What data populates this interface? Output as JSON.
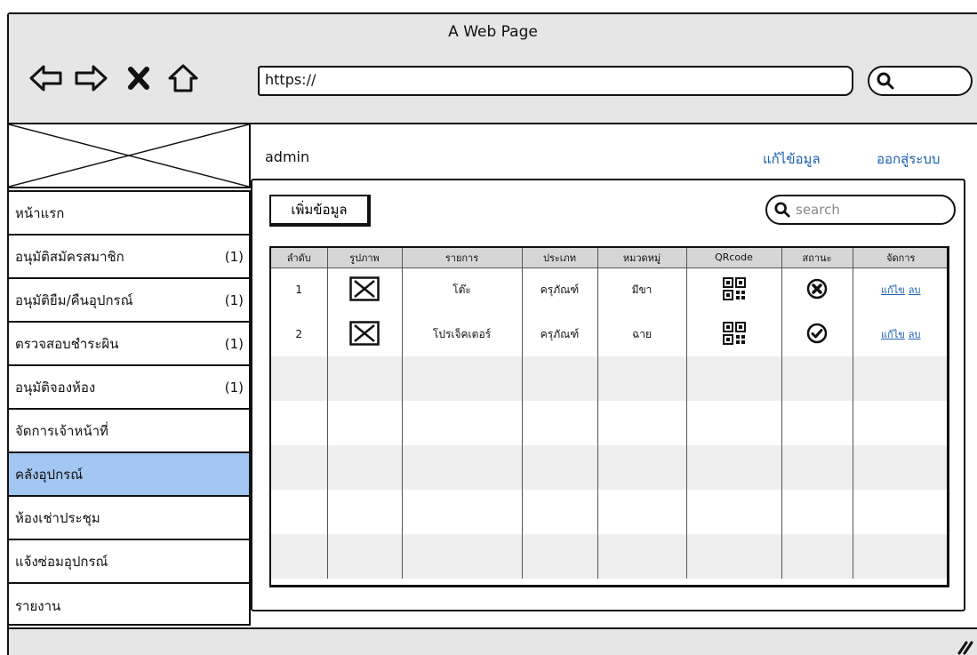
{
  "window": {
    "title": "A Web Page"
  },
  "browser": {
    "url": "https://"
  },
  "user": {
    "name": "admin"
  },
  "top_links": {
    "edit_profile": "แก้ไข้อมูล",
    "logout": "ออกสู่ระบบ"
  },
  "sidebar": {
    "items": [
      {
        "label": "หน้าแรก",
        "count": ""
      },
      {
        "label": "อนุมัติสมัครสมาชิก",
        "count": "(1)"
      },
      {
        "label": "อนุมัติยืม/คืนอุปกรณ์",
        "count": "(1)"
      },
      {
        "label": "ตรวจสอบชำระผิน",
        "count": "(1)"
      },
      {
        "label": "อนุมัติจองห้อง",
        "count": "(1)"
      },
      {
        "label": "จัดการเจ้าหน้าที่",
        "count": ""
      },
      {
        "label": "คลังอุปกรณ์",
        "count": "",
        "active": true
      },
      {
        "label": "ห้องเช่าประชุม",
        "count": ""
      },
      {
        "label": "แจ้งซ่อมอุปกรณ์",
        "count": ""
      },
      {
        "label": "รายงาน",
        "count": ""
      }
    ]
  },
  "toolbar": {
    "add_label": "เพิ่มข้อมูล",
    "search_placeholder": "search"
  },
  "table": {
    "headers": [
      "ลำดับ",
      "รูปภาพ",
      "รายการ",
      "ประเภท",
      "หมวดหมู่",
      "QRcode",
      "สถานะ",
      "จัดการ"
    ],
    "rows": [
      {
        "no": "1",
        "item": "โต๊ะ",
        "type": "ครุภัณฑ์",
        "category": "มีขา",
        "status_icon": "x-circle-icon",
        "edit": "แก้ไข",
        "delete": "ลบ"
      },
      {
        "no": "2",
        "item": "โปรเจ็คเตอร์",
        "type": "ครุภัณฑ์",
        "category": "ฉาย",
        "status_icon": "check-circle-icon",
        "edit": "แก้ไข",
        "delete": "ลบ"
      }
    ]
  },
  "colors": {
    "active_item": "#a3c6f2",
    "link": "#1a5fb4",
    "chrome": "#e6e6e6"
  }
}
